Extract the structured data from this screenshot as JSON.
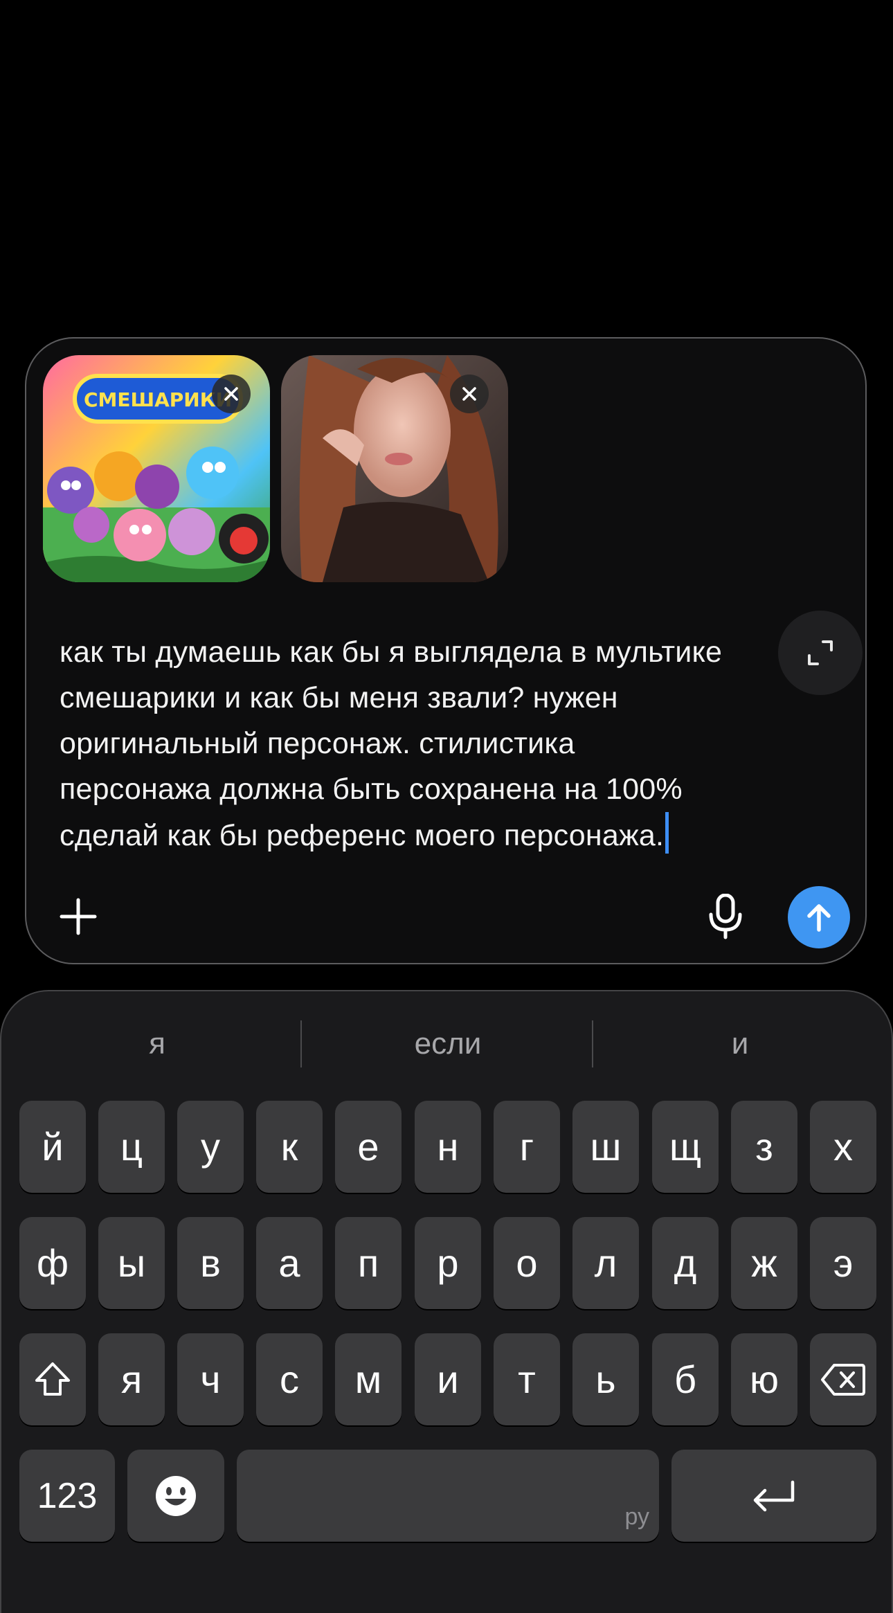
{
  "composer": {
    "attachments": [
      {
        "name": "smeshariki-image",
        "logo_text": "СМЕШАРИКИ"
      },
      {
        "name": "selfie-image"
      }
    ],
    "prompt_text": "как ты думаешь как бы я выглядела в мультике\nсмешарики и как бы меня звали? нужен\nоригинальный персонаж. стилистика\nперсонажа должна быть сохранена на 100%\nсделай как бы референс моего персонажа.",
    "expand_icon": "expand-icon",
    "add_icon": "plus-icon",
    "mic_icon": "microphone-icon",
    "send_icon": "arrow-up-icon"
  },
  "colors": {
    "accent": "#3d8ef5",
    "send_button": "#3f96f2",
    "key_bg": "#3b3b3d",
    "keyboard_bg": "#1a1a1c"
  },
  "keyboard": {
    "suggestions": [
      "я",
      "если",
      "и"
    ],
    "rows": [
      [
        "й",
        "ц",
        "у",
        "к",
        "е",
        "н",
        "г",
        "ш",
        "щ",
        "з",
        "х"
      ],
      [
        "ф",
        "ы",
        "в",
        "а",
        "п",
        "р",
        "о",
        "л",
        "д",
        "ж",
        "э"
      ],
      [
        "я",
        "ч",
        "с",
        "м",
        "и",
        "т",
        "ь",
        "б",
        "ю"
      ]
    ],
    "shift_icon": "shift-icon",
    "backspace_icon": "backspace-icon",
    "numbers_label": "123",
    "emoji_icon": "emoji-icon",
    "space_hint": "ру",
    "return_icon": "return-icon"
  }
}
